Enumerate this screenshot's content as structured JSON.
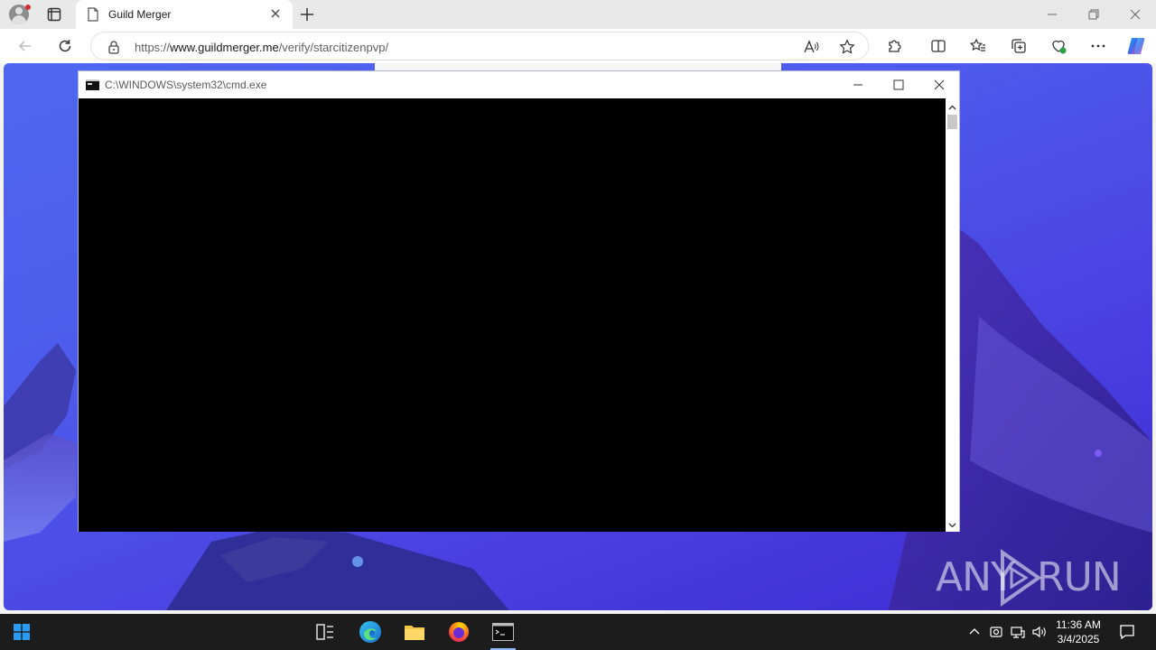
{
  "browser": {
    "tab": {
      "title": "Guild Merger"
    },
    "address": {
      "scheme": "https://",
      "host": "www.guildmerger.me",
      "path": "/verify/starcitizenpvp/"
    }
  },
  "cmd_window": {
    "title": "C:\\WINDOWS\\system32\\cmd.exe"
  },
  "watermark": {
    "left": "ANY",
    "right": "RUN"
  },
  "taskbar": {
    "apps": [
      "task-view",
      "edge",
      "file-explorer",
      "firefox",
      "cmd"
    ],
    "clock": {
      "time": "11:36 AM",
      "date": "3/4/2025"
    }
  },
  "colors": {
    "console_bg": "#000000",
    "desktop_accent": "#4a3fe0",
    "taskbar_bg": "#1c1c1c"
  }
}
